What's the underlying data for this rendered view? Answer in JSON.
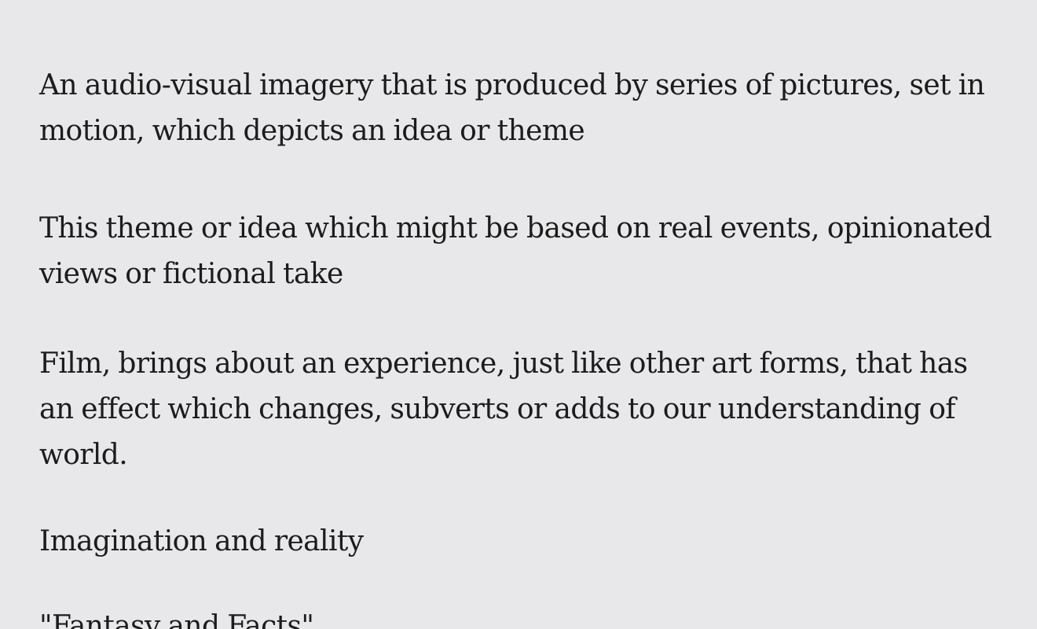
{
  "paragraphs": [
    "An audio-visual imagery that is produced by series of pictures, set in motion, which depicts an idea or theme",
    "This theme or idea which might be based on real events, opinionated views or fictional take",
    "Film, brings about an experience, just like other art forms, that has an effect which changes, subverts or adds to our understanding of world.",
    "Imagination and reality",
    "\"Fantasy and Facts\""
  ]
}
